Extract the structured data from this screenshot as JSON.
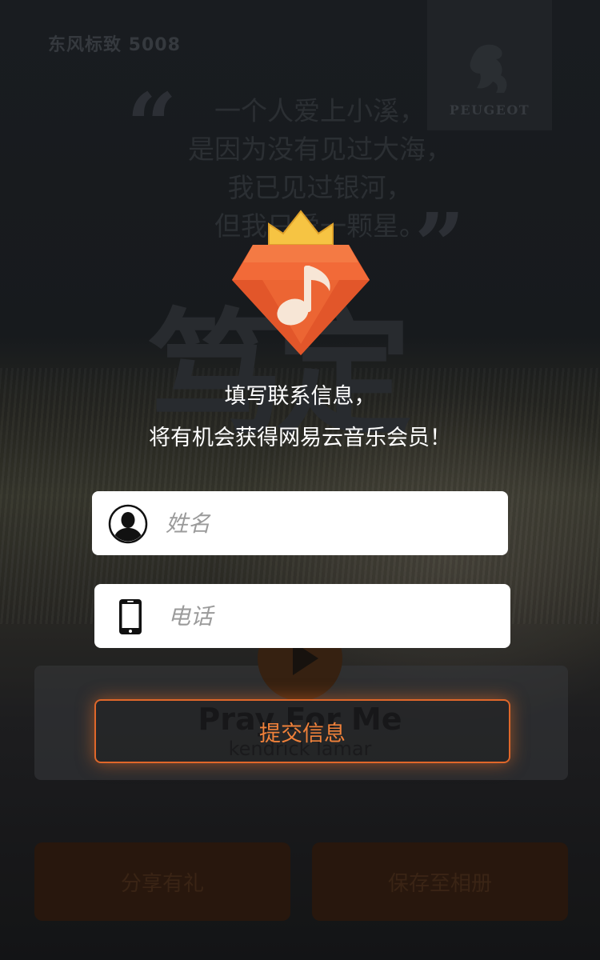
{
  "background": {
    "brand_text": "东风标致 5008",
    "brand_logo_text": "PEUGEOT",
    "quote_open": "“",
    "quote_close": "”",
    "quote_lines": [
      "一个人爱上小溪，",
      "是因为没有见过大海，",
      "我已见过银河，",
      "但我只爱一颗星。"
    ],
    "big_chars": "笃定",
    "song_title": "Pray For Me",
    "song_artist": "kendrick lamar",
    "share_label": "分享有礼",
    "save_label": "保存至相册"
  },
  "modal": {
    "icon": "crown-music-gem-icon",
    "headline_line1": "填写联系信息，",
    "headline_line2": "将有机会获得网易云音乐会员！",
    "name_field": {
      "placeholder": "姓名",
      "value": "",
      "icon": "user-icon"
    },
    "phone_field": {
      "placeholder": "电话",
      "value": "",
      "icon": "phone-icon"
    },
    "submit_label": "提交信息"
  },
  "colors": {
    "accent": "#f0813a",
    "gem_orange": "#f26a38",
    "crown_yellow": "#f6c443",
    "text_white": "#ffffff"
  }
}
